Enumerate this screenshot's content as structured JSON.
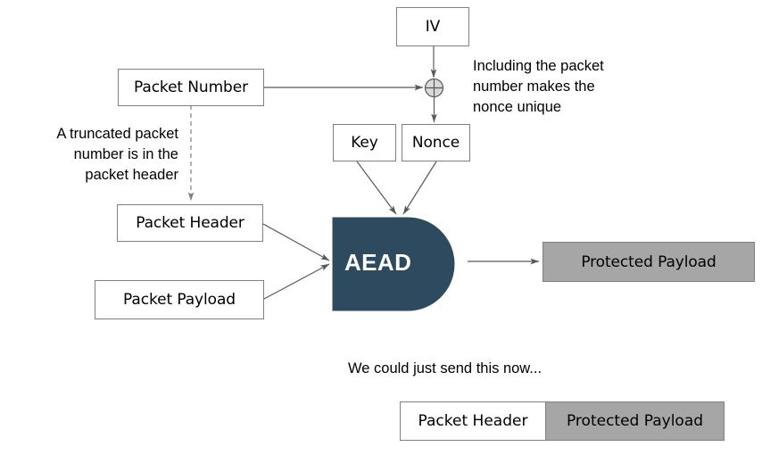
{
  "diagram": {
    "title": "QUIC packet protection AEAD diagram",
    "colors": {
      "aead_fill": "#2d4a5f",
      "gray_fill": "#a6a6a6",
      "box_border": "#808080",
      "line": "#595959",
      "text": "#000000",
      "aead_text": "#ffffff"
    },
    "nodes": {
      "iv": "IV",
      "packet_number": "Packet Number",
      "key": "Key",
      "nonce": "Nonce",
      "packet_header": "Packet Header",
      "packet_payload": "Packet Payload",
      "aead": "AEAD",
      "protected_payload": "Protected Payload"
    },
    "operators": {
      "xor": "xor-circle-icon"
    },
    "annotations": {
      "nonce_note": "Including the packet\nnumber makes the\nnonce unique",
      "truncated_note": "A truncated packet\nnumber is in the\npacket header"
    },
    "caption": "We could just send this now...",
    "result_strip": {
      "header_label": "Packet Header",
      "payload_label": "Protected Payload"
    }
  }
}
